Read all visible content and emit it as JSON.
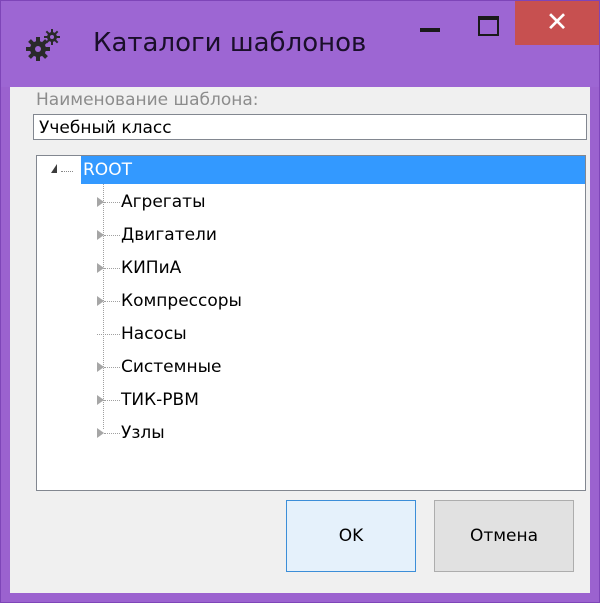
{
  "window": {
    "title": "Каталоги шаблонов",
    "icon": "gears-icon",
    "close_glyph": "✕"
  },
  "form": {
    "name_label": "Наименование шаблона:",
    "name_value": "Учебный класс"
  },
  "tree": {
    "root": {
      "label": "ROOT",
      "expanded": true,
      "selected": true
    },
    "items": [
      {
        "label": "Агрегаты",
        "has_children": true
      },
      {
        "label": "Двигатели",
        "has_children": true
      },
      {
        "label": "КИПиА",
        "has_children": true
      },
      {
        "label": "Компрессоры",
        "has_children": true
      },
      {
        "label": "Насосы",
        "has_children": false
      },
      {
        "label": "Системные",
        "has_children": true
      },
      {
        "label": "ТИК-РВМ",
        "has_children": true
      },
      {
        "label": "Узлы",
        "has_children": true
      }
    ]
  },
  "buttons": {
    "ok_label": "OK",
    "cancel_label": "Отмена"
  },
  "colors": {
    "titlebar": "#9d66d3",
    "close_button": "#c75050",
    "selection": "#3399ff",
    "ok_border": "#3c8ed8"
  }
}
